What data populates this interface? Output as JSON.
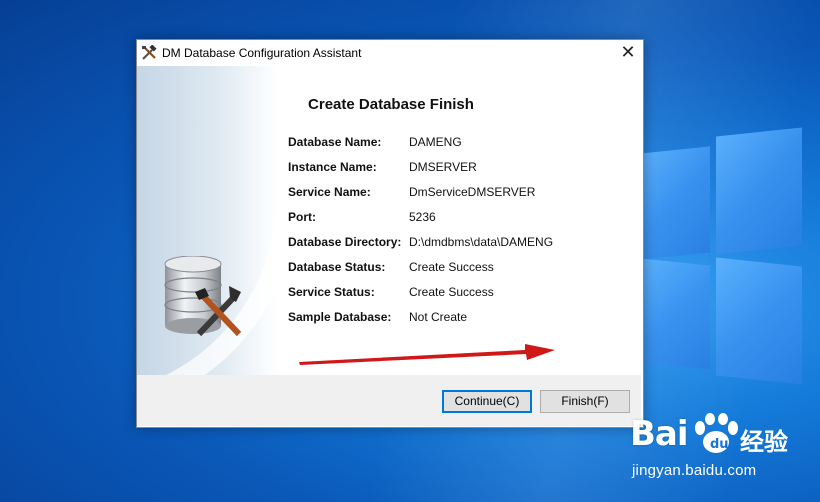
{
  "window": {
    "title": "DM Database Configuration Assistant",
    "close_glyph": "✕"
  },
  "main": {
    "heading": "Create Database Finish",
    "rows": [
      {
        "label": "Database Name:",
        "value": "DAMENG"
      },
      {
        "label": "Instance Name:",
        "value": "DMSERVER"
      },
      {
        "label": "Service Name:",
        "value": "DmServiceDMSERVER"
      },
      {
        "label": "Port:",
        "value": "5236"
      },
      {
        "label": "Database Directory:",
        "value": "D:\\dmdbms\\data\\DAMENG"
      },
      {
        "label": "Database Status:",
        "value": "Create Success"
      },
      {
        "label": "Service Status:",
        "value": "Create Success"
      },
      {
        "label": "Sample Database:",
        "value": "Not Create"
      }
    ]
  },
  "footer": {
    "continue_label": "Continue(C)",
    "finish_label": "Finish(F)"
  },
  "watermark": {
    "logo": "Bai",
    "logo_tail": "du",
    "cn": "经验",
    "url": "jingyan.baidu.com"
  },
  "icons": {
    "app": "tools-icon",
    "illustration": "database-tools-icon",
    "annotation": "red-arrow-icon"
  },
  "colors": {
    "accent": "#0078d7",
    "arrow": "#d01818"
  }
}
